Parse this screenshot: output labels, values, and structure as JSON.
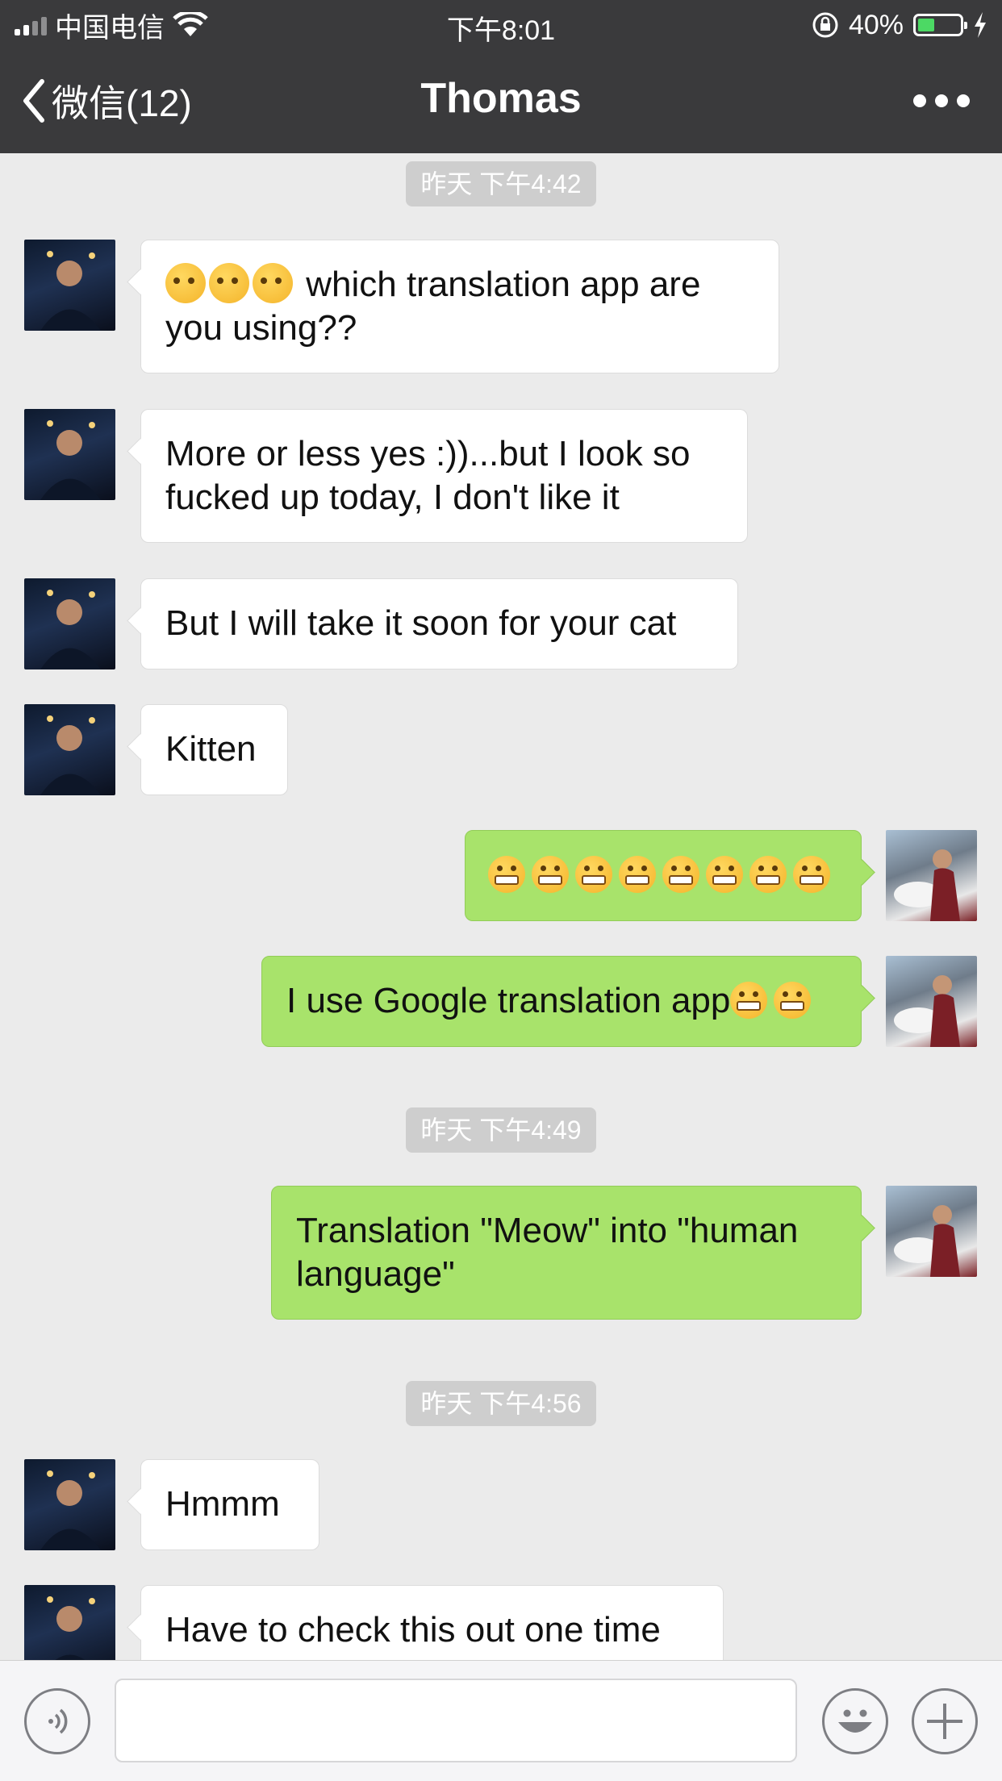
{
  "status_bar": {
    "carrier": "中国电信",
    "time": "下午8:01",
    "battery_percent": "40%",
    "battery_level": 0.4,
    "signal_bars": 2
  },
  "nav": {
    "back_label": "微信(12)",
    "title": "Thomas",
    "more_icon": "more-dots-icon"
  },
  "timestamps": {
    "t1": "昨天 下午4:42",
    "t2": "昨天 下午4:49",
    "t3": "昨天 下午4:56"
  },
  "messages": {
    "m1": "which translation app are you using??",
    "m2": "More or less yes :))...but I look so fucked up today, I don't like it",
    "m3": "But I will take it soon for your cat",
    "m4": "Kitten",
    "m5": "",
    "m6": "I use Google translation app",
    "m7": "Translation \"Meow\" into \"human language\"",
    "m8": "Hmmm",
    "m9": "Have to check this out one time"
  },
  "input_bar": {
    "voice_icon": "voice-icon",
    "emoji_icon": "emoji-icon",
    "plus_icon": "plus-icon",
    "text_value": ""
  },
  "colors": {
    "bar_bg": "#3a3a3c",
    "chat_bg": "#ebebeb",
    "outgoing_bubble": "#a8e36b",
    "incoming_bubble": "#ffffff"
  }
}
